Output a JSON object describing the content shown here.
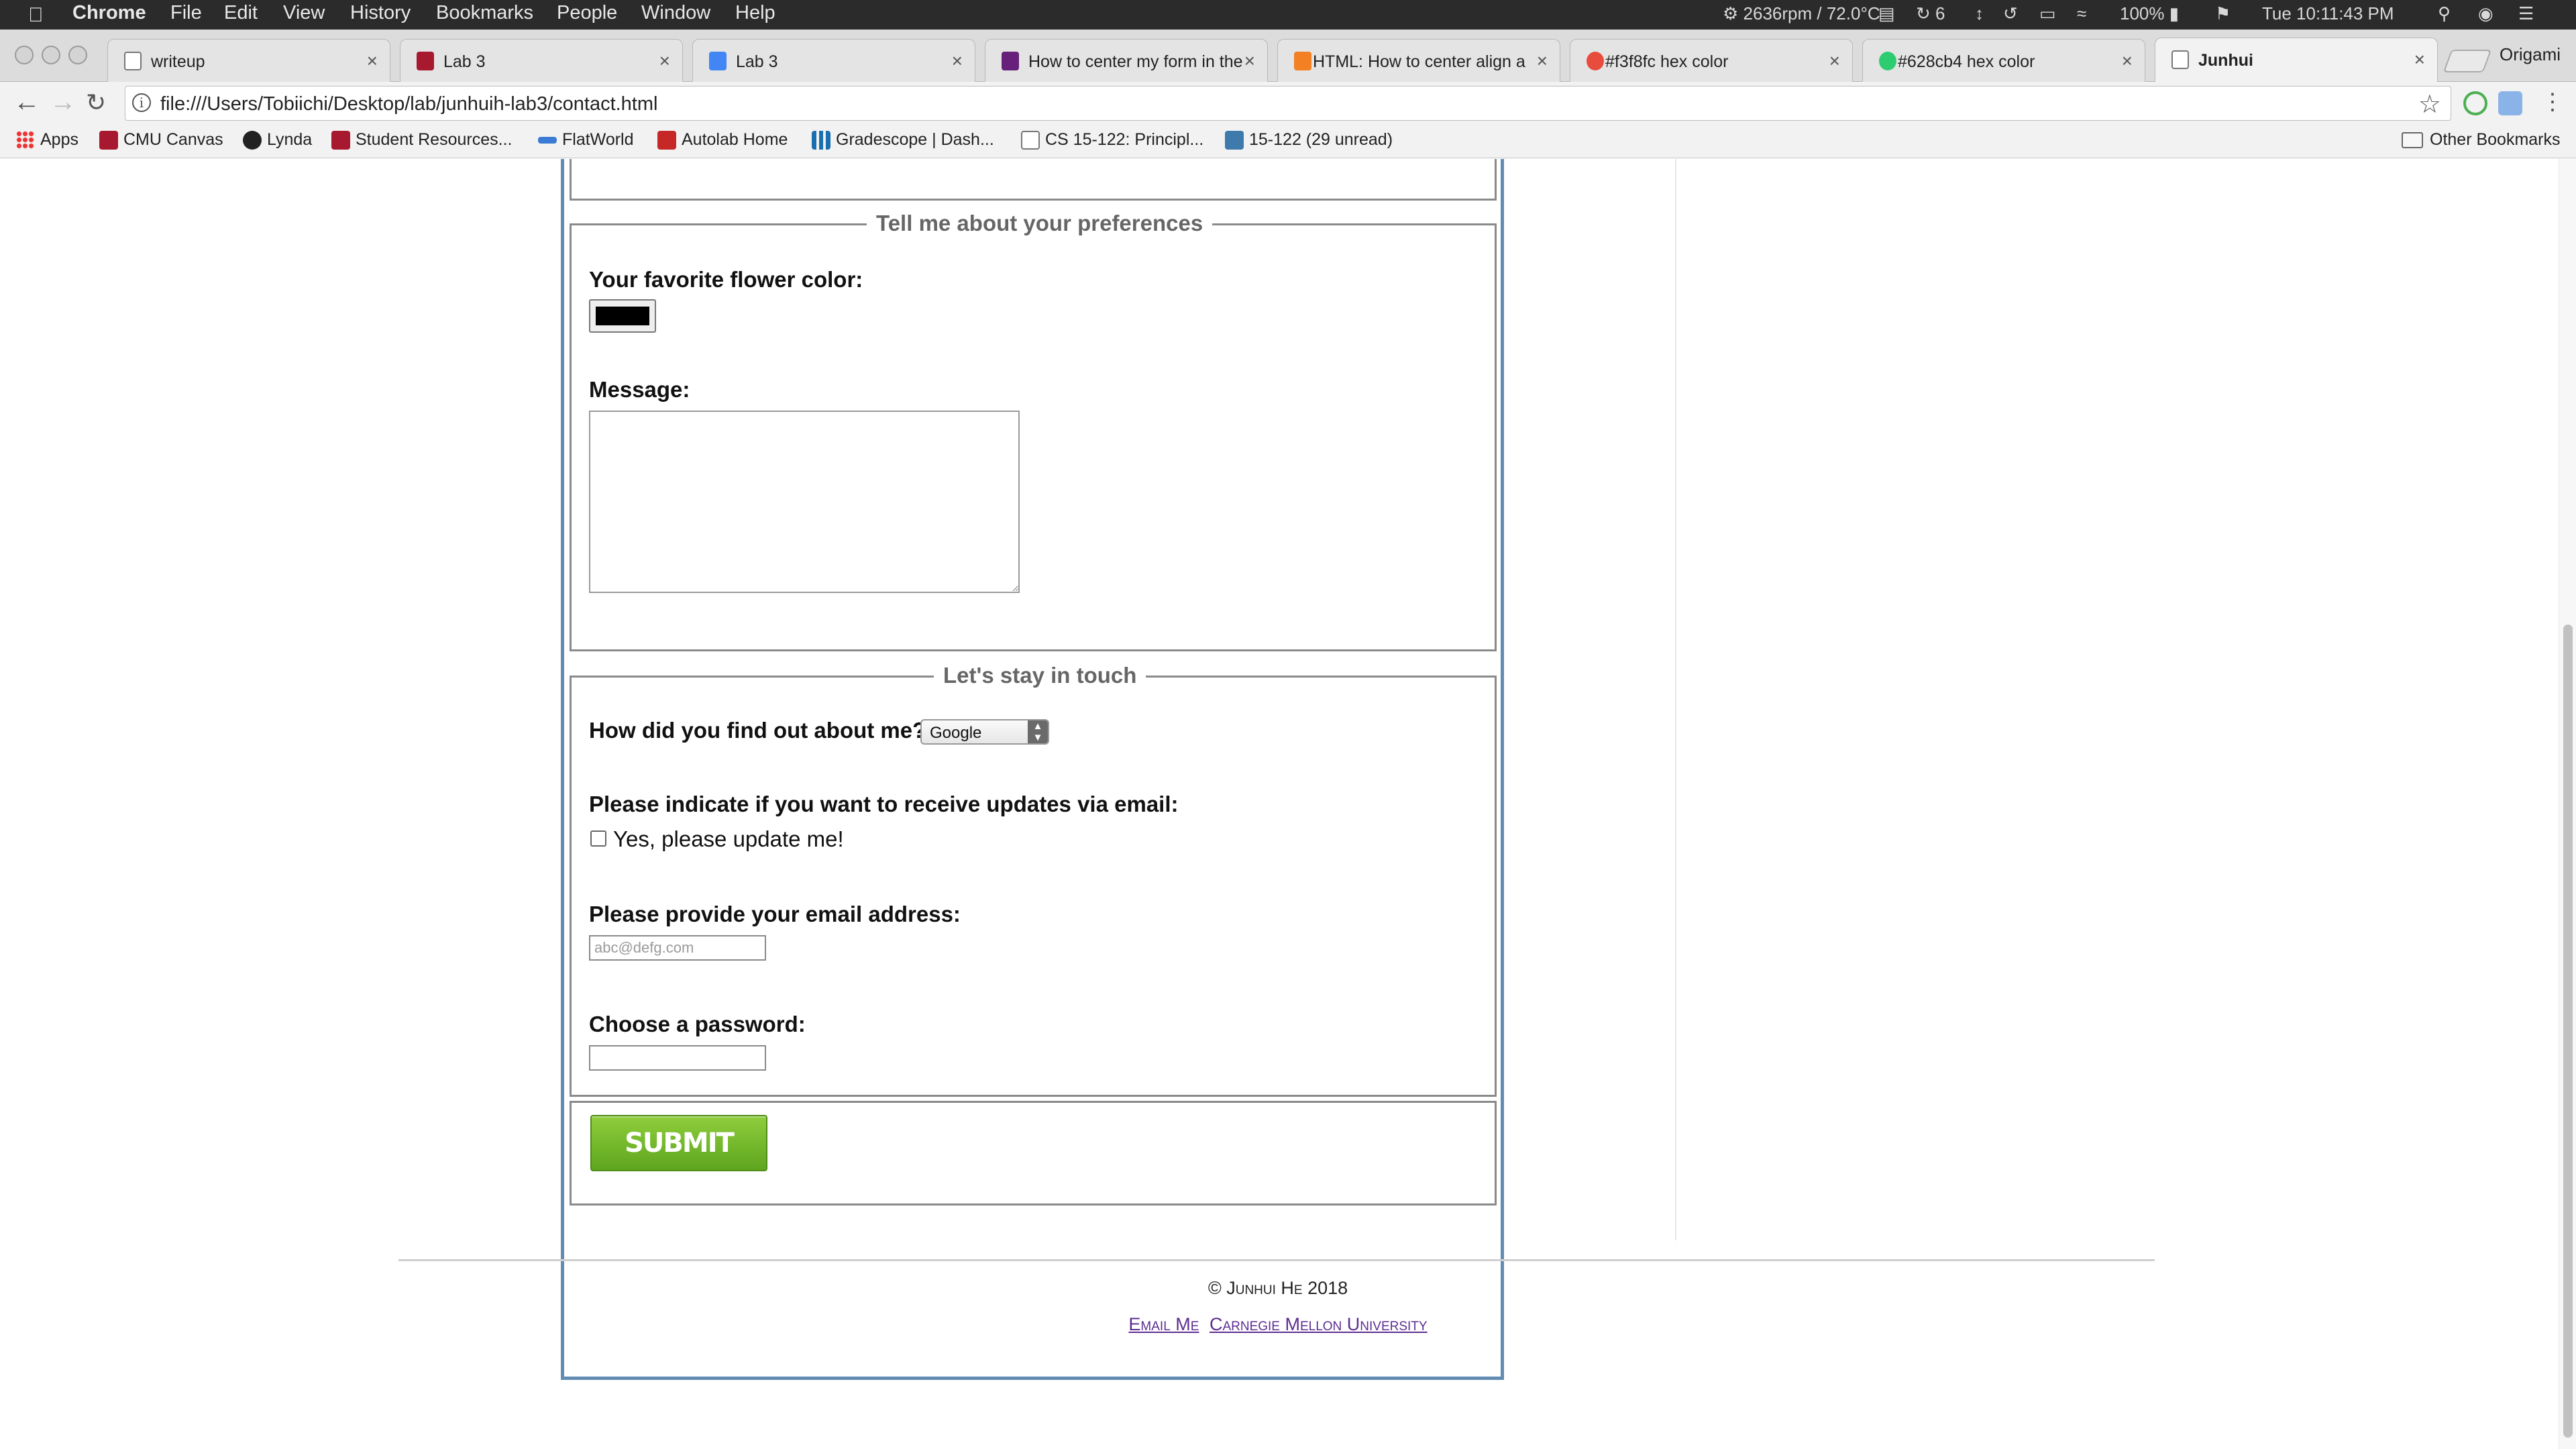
{
  "menubar": {
    "app": "Chrome",
    "items": [
      "File",
      "Edit",
      "View",
      "History",
      "Bookmarks",
      "People",
      "Window",
      "Help"
    ],
    "status": {
      "fan": "2636rpm / 72.0°C",
      "count": "6",
      "battery": "100%",
      "clock": "Tue 10:11:43 PM"
    }
  },
  "tabs": [
    {
      "title": "writeup",
      "favicon_color": "#ffffff",
      "active": false
    },
    {
      "title": "Lab 3",
      "favicon_color": "#a6192e",
      "active": false
    },
    {
      "title": "Lab 3",
      "favicon_color": "#4285f4",
      "active": false
    },
    {
      "title": "How to center my form in the",
      "favicon_color": "#68217a",
      "active": false
    },
    {
      "title": "HTML: How to center align a",
      "favicon_color": "#f48024",
      "active": false
    },
    {
      "title": "#f3f8fc hex color",
      "favicon_color": "#e74c3c",
      "active": false
    },
    {
      "title": "#628cb4 hex color",
      "favicon_color": "#2ecc71",
      "active": false
    },
    {
      "title": "Junhui",
      "favicon_color": "#ffffff",
      "active": true
    }
  ],
  "profile_name": "Origami",
  "address": {
    "url": "file:///Users/Tobiichi/Desktop/lab/junhuih-lab3/contact.html"
  },
  "bookmarks": {
    "items": [
      {
        "label": "Apps",
        "icon": "apps-grid-icon",
        "color": "#e33333"
      },
      {
        "label": "CMU Canvas",
        "icon": "canvas-icon",
        "color": "#a6192e"
      },
      {
        "label": "Lynda",
        "icon": "lynda-icon",
        "color": "#222222"
      },
      {
        "label": "Student Resources...",
        "icon": "canvas-icon",
        "color": "#a6192e"
      },
      {
        "label": "FlatWorld",
        "icon": "flatworld-icon",
        "color": "#3a7bd5"
      },
      {
        "label": "Autolab Home",
        "icon": "autolab-icon",
        "color": "#c62828"
      },
      {
        "label": "Gradescope | Dash...",
        "icon": "gradescope-icon",
        "color": "#1a6fb0"
      },
      {
        "label": "CS 15-122: Principl...",
        "icon": "page-icon",
        "color": "#ffffff"
      },
      {
        "label": "15-122 (29 unread)",
        "icon": "piazza-icon",
        "color": "#3e7aab"
      }
    ],
    "other": "Other Bookmarks"
  },
  "form": {
    "preferences": {
      "legend": "Tell me about your preferences",
      "flower_label": "Your favorite flower color:",
      "flower_color": "#000000",
      "message_label": "Message:",
      "message_value": ""
    },
    "stay_in_touch": {
      "legend": "Let's stay in touch",
      "found_label": "How did you find out about me?",
      "found_value": "Google",
      "updates_label": "Please indicate if you want to receive updates via email:",
      "updates_option": "Yes, please update me!",
      "updates_checked": false,
      "email_label": "Please provide your email address:",
      "email_placeholder": "abc@defg.com",
      "password_label": "Choose a password:"
    },
    "submit_label": "SUBMIT"
  },
  "footer": {
    "copyright": "© Junhui He 2018",
    "links": [
      "Email Me",
      "Carnegie Mellon University"
    ]
  },
  "colors": {
    "form_border": "#628cb4",
    "submit_green": "#6cb52b",
    "link_purple": "#5c2d91"
  }
}
